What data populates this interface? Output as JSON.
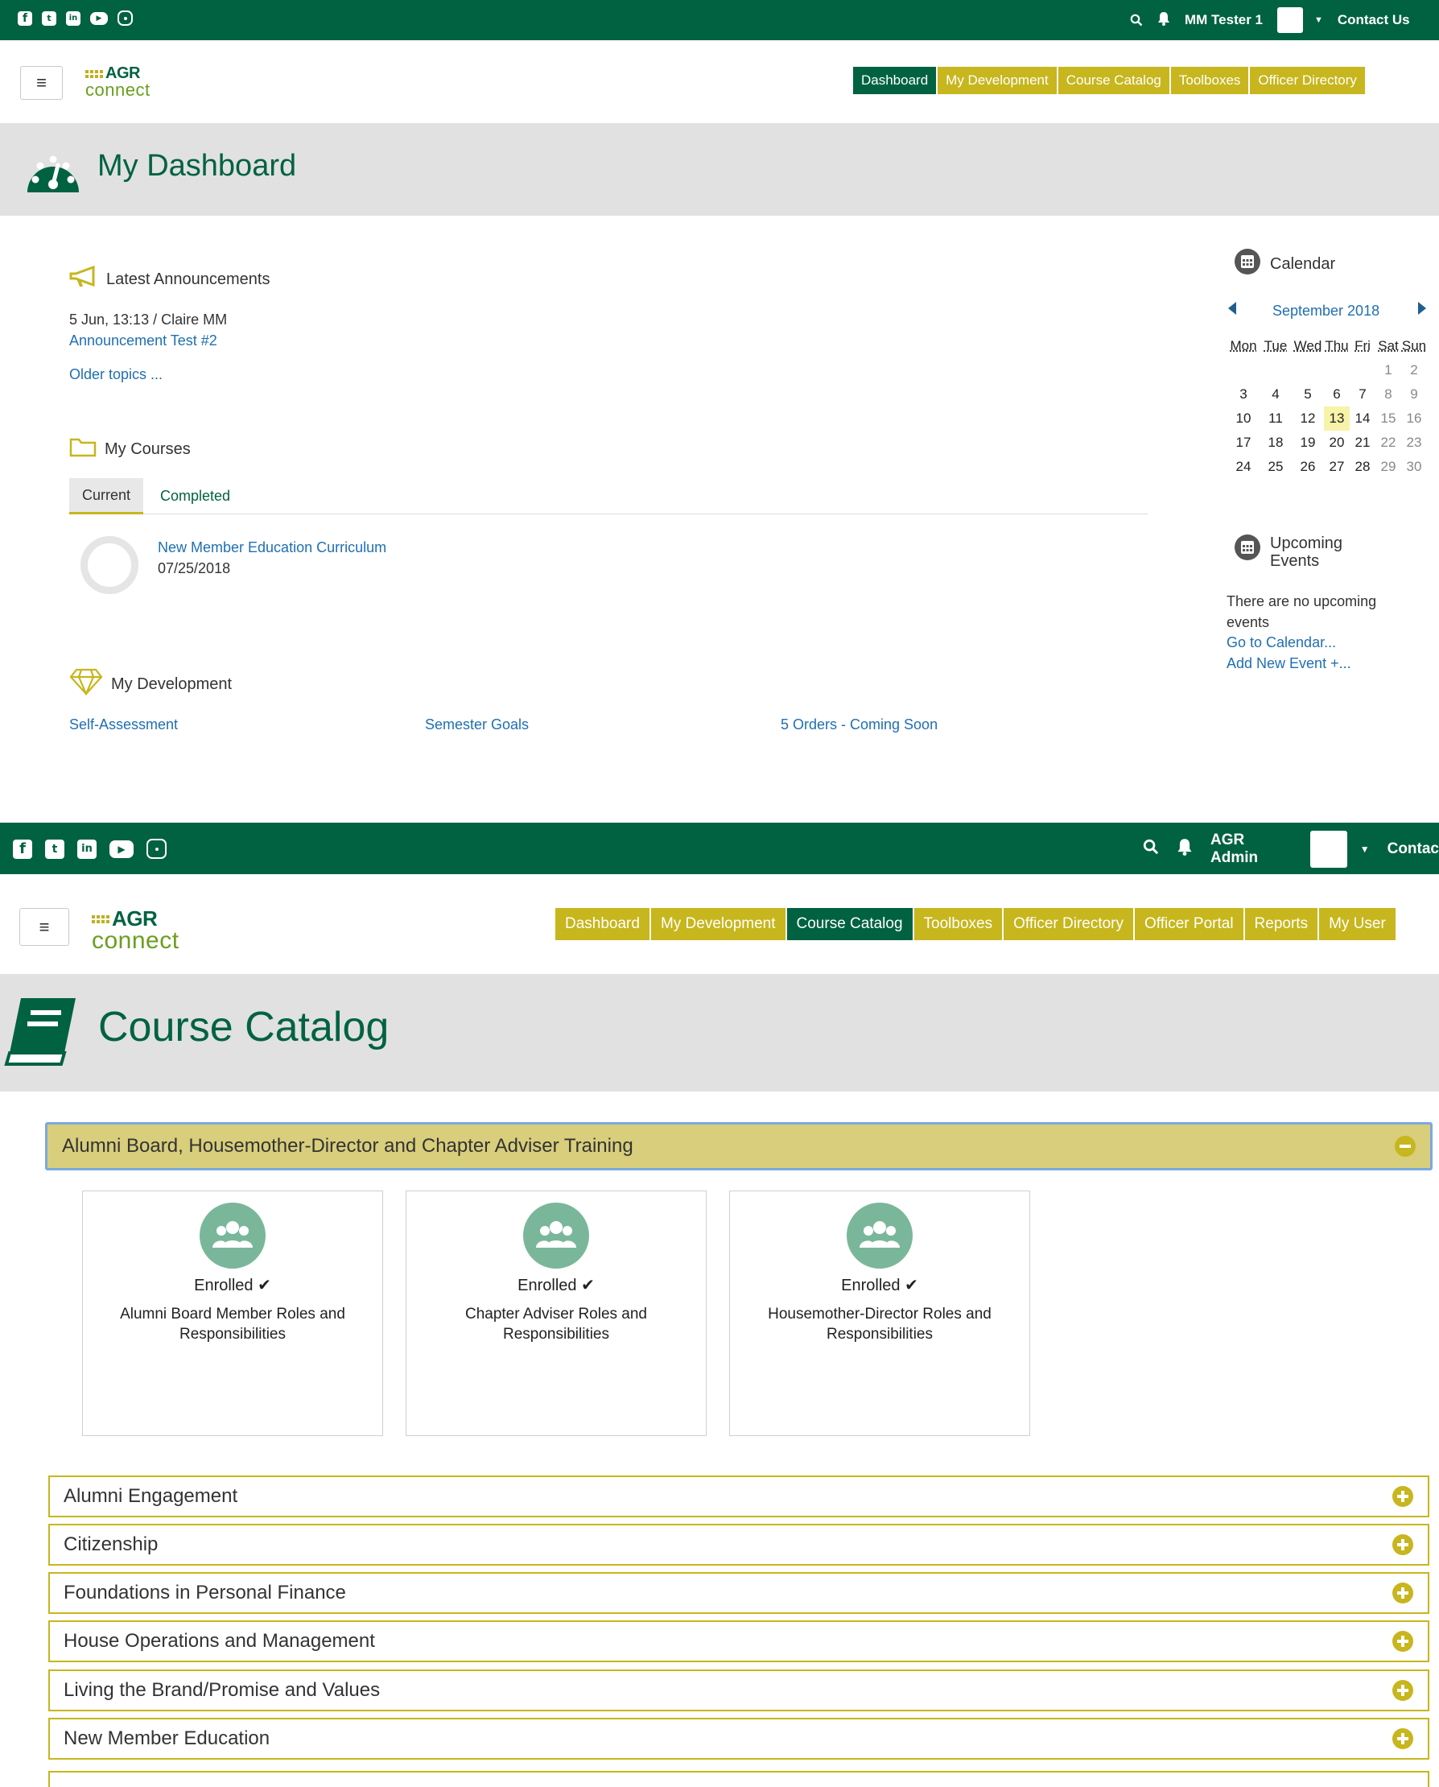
{
  "dashboard": {
    "topbar": {
      "user_name": "MM Tester 1",
      "contact": "Contact Us"
    },
    "nav": [
      "Dashboard",
      "My Development",
      "Course Catalog",
      "Toolboxes",
      "Officer Directory"
    ],
    "logo": {
      "agr": "AGR",
      "connect": "connect"
    },
    "page_title": "My Dashboard",
    "announcements": {
      "heading": "Latest Announcements",
      "meta": "5 Jun, 13:13 / Claire MM",
      "item": "Announcement Test #2",
      "older": "Older topics ..."
    },
    "courses": {
      "heading": "My Courses",
      "tabs": [
        "Current",
        "Completed"
      ],
      "item_title": "New Member Education Curriculum",
      "item_date": "07/25/2018",
      "progress": "0%"
    },
    "development": {
      "heading": "My Development",
      "links": [
        "Self-Assessment",
        "Semester Goals",
        "5 Orders - Coming Soon"
      ]
    },
    "calendar": {
      "heading": "Calendar",
      "month": "September 2018",
      "days": [
        "Mon",
        "Tue",
        "Wed",
        "Thu",
        "Fri",
        "Sat",
        "Sun"
      ],
      "weeks": [
        [
          "",
          "",
          "",
          "",
          "",
          "1",
          "2"
        ],
        [
          "3",
          "4",
          "5",
          "6",
          "7",
          "8",
          "9"
        ],
        [
          "10",
          "11",
          "12",
          "13",
          "14",
          "15",
          "16"
        ],
        [
          "17",
          "18",
          "19",
          "20",
          "21",
          "22",
          "23"
        ],
        [
          "24",
          "25",
          "26",
          "27",
          "28",
          "29",
          "30"
        ]
      ],
      "today": "13"
    },
    "upcoming": {
      "heading_line1": "Upcoming",
      "heading_line2": "Events",
      "empty": "There are no upcoming events",
      "go": "Go to Calendar...",
      "add": "Add New Event +..."
    }
  },
  "catalog": {
    "topbar": {
      "user_name": "AGR Admin",
      "contact": "Contac"
    },
    "nav": [
      "Dashboard",
      "My Development",
      "Course Catalog",
      "Toolboxes",
      "Officer Directory",
      "Officer Portal",
      "Reports",
      "My User"
    ],
    "page_title": "Course Catalog",
    "open_category": "Alumni Board, Housemother-Director and Chapter Adviser Training",
    "cards": [
      {
        "status": "Enrolled",
        "title": "Alumni Board Member Roles and Responsibilities"
      },
      {
        "status": "Enrolled",
        "title": "Chapter Adviser Roles and Responsibilities"
      },
      {
        "status": "Enrolled",
        "title": "Housemother-Director Roles and Responsibilities"
      }
    ],
    "categories": [
      "Alumni Engagement",
      "Citizenship",
      "Foundations in Personal Finance",
      "House Operations and Management",
      "Living the Brand/Promise and Values",
      "New Member Education"
    ]
  },
  "colors": {
    "green": "#006241",
    "gold": "#c7b61d",
    "band": "#e1e1e1",
    "link": "#1f6fb2"
  }
}
